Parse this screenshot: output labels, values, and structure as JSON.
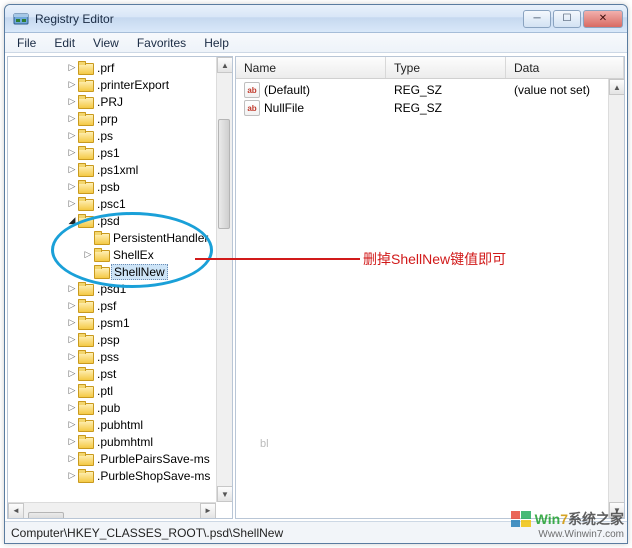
{
  "window": {
    "title": "Registry Editor"
  },
  "menu": {
    "file": "File",
    "edit": "Edit",
    "view": "View",
    "favorites": "Favorites",
    "help": "Help"
  },
  "tree": {
    "items": [
      {
        "label": ".prf",
        "depth": 3,
        "toggle": "closed"
      },
      {
        "label": ".printerExport",
        "depth": 3,
        "toggle": "closed"
      },
      {
        "label": ".PRJ",
        "depth": 3,
        "toggle": "closed"
      },
      {
        "label": ".prp",
        "depth": 3,
        "toggle": "closed"
      },
      {
        "label": ".ps",
        "depth": 3,
        "toggle": "closed"
      },
      {
        "label": ".ps1",
        "depth": 3,
        "toggle": "closed"
      },
      {
        "label": ".ps1xml",
        "depth": 3,
        "toggle": "closed"
      },
      {
        "label": ".psb",
        "depth": 3,
        "toggle": "closed"
      },
      {
        "label": ".psc1",
        "depth": 3,
        "toggle": "closed"
      },
      {
        "label": ".psd",
        "depth": 3,
        "toggle": "open"
      },
      {
        "label": "PersistentHandler",
        "depth": 4,
        "toggle": "none"
      },
      {
        "label": "ShellEx",
        "depth": 4,
        "toggle": "closed"
      },
      {
        "label": "ShellNew",
        "depth": 4,
        "toggle": "none",
        "selected": true
      },
      {
        "label": ".psd1",
        "depth": 3,
        "toggle": "closed"
      },
      {
        "label": ".psf",
        "depth": 3,
        "toggle": "closed"
      },
      {
        "label": ".psm1",
        "depth": 3,
        "toggle": "closed"
      },
      {
        "label": ".psp",
        "depth": 3,
        "toggle": "closed"
      },
      {
        "label": ".pss",
        "depth": 3,
        "toggle": "closed"
      },
      {
        "label": ".pst",
        "depth": 3,
        "toggle": "closed"
      },
      {
        "label": ".ptl",
        "depth": 3,
        "toggle": "closed"
      },
      {
        "label": ".pub",
        "depth": 3,
        "toggle": "closed"
      },
      {
        "label": ".pubhtml",
        "depth": 3,
        "toggle": "closed"
      },
      {
        "label": ".pubmhtml",
        "depth": 3,
        "toggle": "closed"
      },
      {
        "label": ".PurblePairsSave-ms",
        "depth": 3,
        "toggle": "closed"
      },
      {
        "label": ".PurbleShopSave-ms",
        "depth": 3,
        "toggle": "closed"
      }
    ]
  },
  "list": {
    "columns": {
      "name": "Name",
      "type": "Type",
      "data": "Data"
    },
    "rows": [
      {
        "name": "(Default)",
        "type": "REG_SZ",
        "data": "(value not set)"
      },
      {
        "name": "NullFile",
        "type": "REG_SZ",
        "data": ""
      }
    ]
  },
  "status": {
    "path": "Computer\\HKEY_CLASSES_ROOT\\.psd\\ShellNew"
  },
  "annotation": {
    "text": "删掉ShellNew键值即可"
  },
  "watermark": {
    "brand_a": "Win",
    "brand_b": "7",
    "brand_c": "系统之家",
    "url": "Www.Winwin7.com",
    "faint": "bl"
  }
}
